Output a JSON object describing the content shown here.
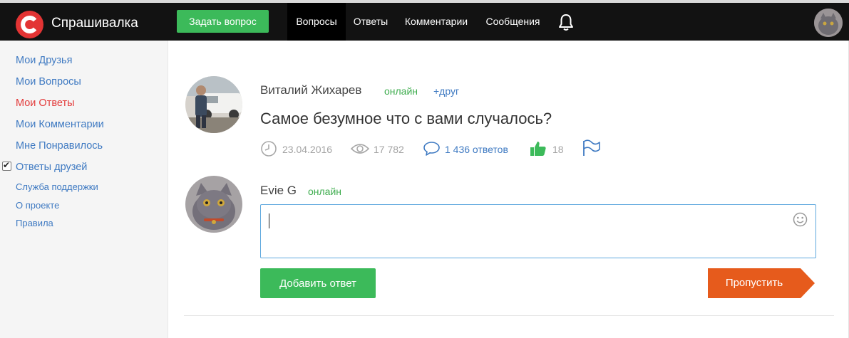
{
  "header": {
    "brand": "Спрашивалка",
    "ask_button": "Задать вопрос",
    "nav": [
      "Вопросы",
      "Ответы",
      "Комментарии",
      "Сообщения"
    ],
    "active_nav": "Вопросы"
  },
  "sidebar": {
    "links": [
      "Мои Друзья",
      "Мои Вопросы",
      "Мои Ответы",
      "Мои Комментарии",
      "Мне Понравилось",
      "Ответы друзей"
    ],
    "active_link": "Мои Ответы",
    "small_links": [
      "Служба поддержки",
      "О проекте",
      "Правила"
    ]
  },
  "question": {
    "author": "Виталий Жихарев",
    "author_status": "онлайн",
    "add_friend": "+друг",
    "title": "Самое безумное что с вами случалось?",
    "date": "23.04.2016",
    "views": "17 782",
    "answers": "1 436 ответов",
    "likes": "18"
  },
  "reply": {
    "user": "Evie G",
    "user_status": "онлайн",
    "input_value": "",
    "add_button": "Добавить ответ",
    "skip_button": "Пропустить"
  },
  "colors": {
    "header_bg": "#121212",
    "brand_red": "#e33434",
    "green": "#3cba5a",
    "link_blue": "#3f7ac2",
    "skip_orange": "#e65b1c"
  },
  "icons": [
    "logo-icon",
    "bell-icon",
    "clock-icon",
    "eye-icon",
    "comment-icon",
    "thumbs-up-icon",
    "flag-icon",
    "smile-icon"
  ]
}
